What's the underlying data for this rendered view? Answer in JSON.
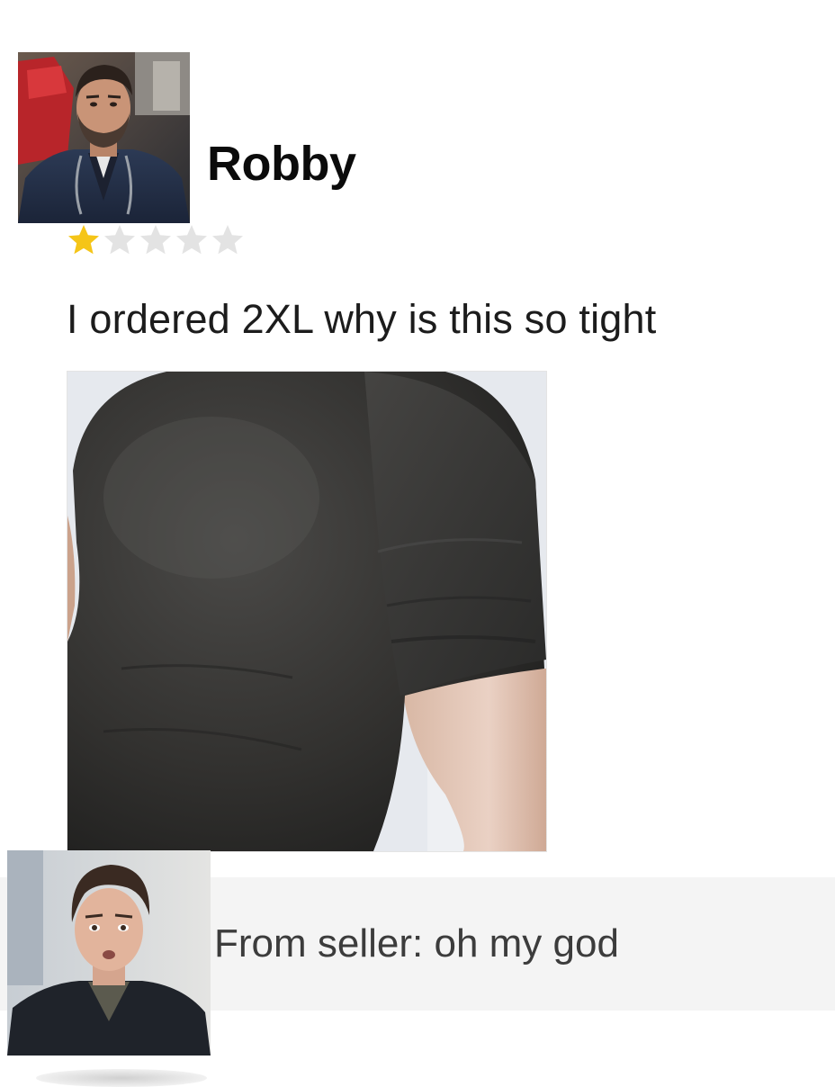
{
  "review": {
    "reviewer_name": "Robby",
    "reviewer_avatar_icon": "reviewer-avatar-photo",
    "rating": 1,
    "rating_max": 5,
    "star_filled_color": "#f5c518",
    "star_empty_color": "#e3e3e3",
    "text": "I ordered 2XL why is this so tight",
    "photo_icon": "review-photo-tight-shirt"
  },
  "seller_reply": {
    "text": "From seller: oh my god",
    "seller_avatar_icon": "seller-avatar-photo",
    "background_color": "#f4f4f4"
  }
}
